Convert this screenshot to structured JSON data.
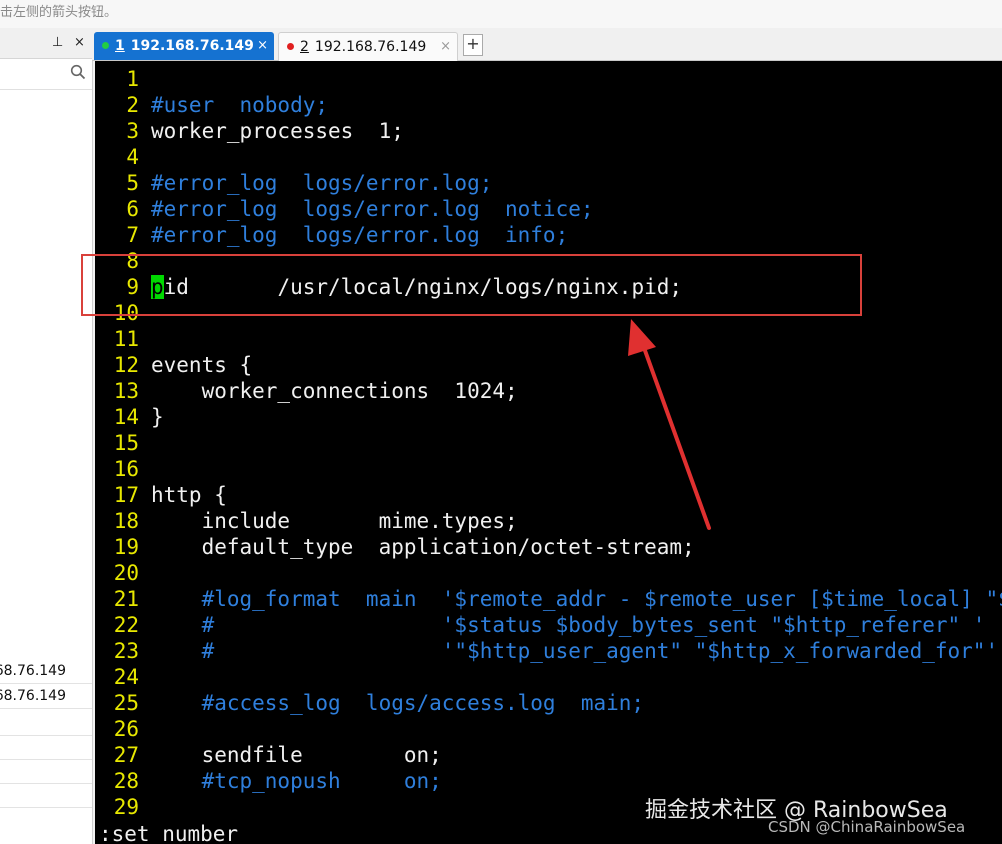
{
  "top_hint": "击左侧的箭头按钮。",
  "sidebar": {
    "pin_glyph": "⊥",
    "close_glyph": "×",
    "search_icon": "search-icon",
    "items": [
      {
        "label": "68.76.149"
      },
      {
        "label": "68.76.149"
      }
    ]
  },
  "tabs": [
    {
      "number": "1",
      "title": "192.168.76.149",
      "status_color": "#22cc44",
      "close": "×"
    },
    {
      "number": "2",
      "title": "192.168.76.149",
      "status_color": "#e02020",
      "close": "×"
    }
  ],
  "add_tab_label": "+",
  "editor": {
    "lines": [
      {
        "n": "1",
        "segments": []
      },
      {
        "n": "2",
        "segments": [
          {
            "t": "#user  nobody;",
            "c": "cmt"
          }
        ]
      },
      {
        "n": "3",
        "segments": [
          {
            "t": "worker_processes  1;",
            "c": "w"
          }
        ]
      },
      {
        "n": "4",
        "segments": []
      },
      {
        "n": "5",
        "segments": [
          {
            "t": "#error_log  logs/error.log;",
            "c": "cmt"
          }
        ]
      },
      {
        "n": "6",
        "segments": [
          {
            "t": "#error_log  logs/error.log  notice;",
            "c": "cmt"
          }
        ]
      },
      {
        "n": "7",
        "segments": [
          {
            "t": "#error_log  logs/error.log  info;",
            "c": "cmt"
          }
        ]
      },
      {
        "n": "8",
        "segments": []
      },
      {
        "n": "9",
        "segments": [
          {
            "t": "p",
            "c": "cursor"
          },
          {
            "t": "id       /usr/local/nginx/logs/nginx.pid;",
            "c": "w"
          }
        ]
      },
      {
        "n": "10",
        "segments": []
      },
      {
        "n": "11",
        "segments": []
      },
      {
        "n": "12",
        "segments": [
          {
            "t": "events {",
            "c": "w"
          }
        ]
      },
      {
        "n": "13",
        "segments": [
          {
            "t": "    worker_connections  1024;",
            "c": "w"
          }
        ]
      },
      {
        "n": "14",
        "segments": [
          {
            "t": "}",
            "c": "w"
          }
        ]
      },
      {
        "n": "15",
        "segments": []
      },
      {
        "n": "16",
        "segments": []
      },
      {
        "n": "17",
        "segments": [
          {
            "t": "http {",
            "c": "w"
          }
        ]
      },
      {
        "n": "18",
        "segments": [
          {
            "t": "    include       mime.types;",
            "c": "w"
          }
        ]
      },
      {
        "n": "19",
        "segments": [
          {
            "t": "    default_type  application/octet-stream;",
            "c": "w"
          }
        ]
      },
      {
        "n": "20",
        "segments": []
      },
      {
        "n": "21",
        "segments": [
          {
            "t": "    #log_format  main  '$remote_addr - $remote_user [$time_local] \"$request\" '",
            "c": "cmt"
          }
        ]
      },
      {
        "n": "22",
        "segments": [
          {
            "t": "    #                  '$status $body_bytes_sent \"$http_referer\" '",
            "c": "cmt"
          }
        ]
      },
      {
        "n": "23",
        "segments": [
          {
            "t": "    #                  '\"$http_user_agent\" \"$http_x_forwarded_for\"';",
            "c": "cmt"
          }
        ]
      },
      {
        "n": "24",
        "segments": []
      },
      {
        "n": "25",
        "segments": [
          {
            "t": "    #access_log  logs/access.log  main;",
            "c": "cmt"
          }
        ]
      },
      {
        "n": "26",
        "segments": []
      },
      {
        "n": "27",
        "segments": [
          {
            "t": "    sendfile        on;",
            "c": "w"
          }
        ]
      },
      {
        "n": "28",
        "segments": [
          {
            "t": "    #tcp_nopush     on;",
            "c": "cmt"
          }
        ]
      },
      {
        "n": "29",
        "segments": []
      }
    ],
    "command_line": ":set number"
  },
  "watermark": {
    "primary": "掘金技术社区 @ RainbowSea",
    "secondary": "CSDN @ChinaRainbowSea"
  },
  "annotation_color": "#d9413b"
}
